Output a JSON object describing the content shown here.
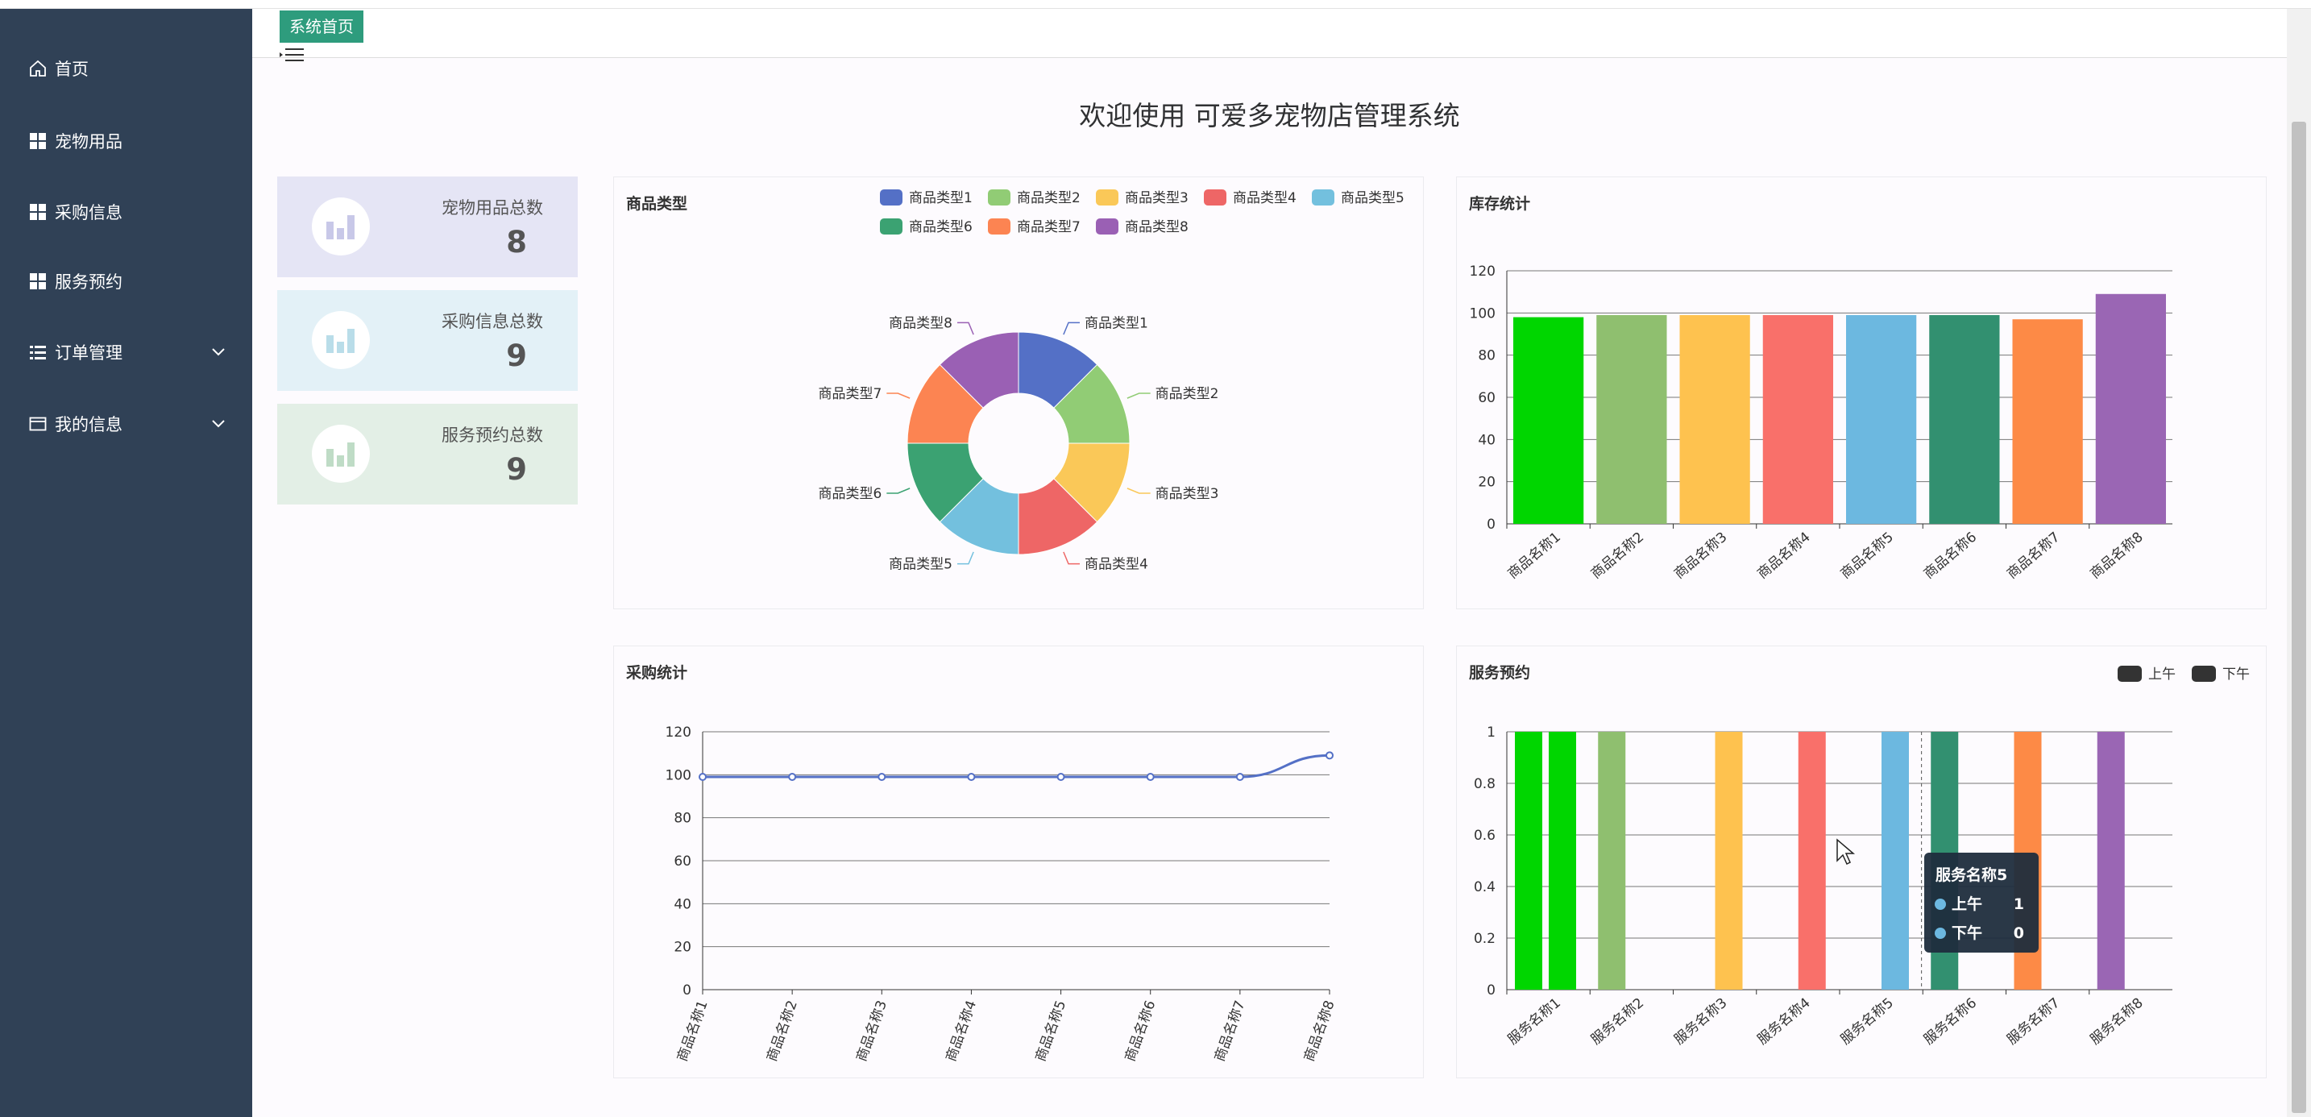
{
  "app": {
    "title": "欢迎使用 可爱多宠物店管理系统",
    "tab": "系统首页"
  },
  "sidebar": {
    "items": [
      {
        "label": "首页",
        "icon": "home-icon"
      },
      {
        "label": "宠物用品",
        "icon": "grid-icon"
      },
      {
        "label": "采购信息",
        "icon": "grid-icon"
      },
      {
        "label": "服务预约",
        "icon": "grid-icon"
      },
      {
        "label": "订单管理",
        "icon": "list-icon"
      },
      {
        "label": "我的信息",
        "icon": "card-icon"
      }
    ]
  },
  "stats": [
    {
      "label": "宠物用品总数",
      "value": "8",
      "bg": "#e5e5f5",
      "icon_color": "#c8c8e8"
    },
    {
      "label": "采购信息总数",
      "value": "9",
      "bg": "#e3f1f7",
      "icon_color": "#b9dde9"
    },
    {
      "label": "服务预约总数",
      "value": "9",
      "bg": "#e3efe6",
      "icon_color": "#bfdcc6"
    }
  ],
  "colors": {
    "sidebar": "#304156",
    "tab": "#2e9c7d",
    "line": "#5470c6"
  },
  "chart_data": [
    {
      "type": "pie",
      "title": "商品类型",
      "legend": "top-right",
      "labels": [
        "商品类型1",
        "商品类型2",
        "商品类型3",
        "商品类型4",
        "商品类型5",
        "商品类型6",
        "商品类型7",
        "商品类型8"
      ],
      "values": [
        1,
        1,
        1,
        1,
        1,
        1,
        1,
        1
      ],
      "colors": [
        "#5470c6",
        "#91cc75",
        "#fac858",
        "#ee6666",
        "#73c0de",
        "#3ba272",
        "#fc8452",
        "#9a60b4"
      ]
    },
    {
      "type": "bar",
      "title": "库存统计",
      "categories": [
        "商品名称1",
        "商品名称2",
        "商品名称3",
        "商品名称4",
        "商品名称5",
        "商品名称6",
        "商品名称7",
        "商品名称8"
      ],
      "values": [
        98,
        99,
        99,
        99,
        99,
        99,
        97,
        109
      ],
      "colors": [
        "#00d600",
        "#8fbf6f",
        "#fec24f",
        "#f9706a",
        "#6cb8e0",
        "#329070",
        "#fd8a46",
        "#9a66b4"
      ],
      "ylim": [
        0,
        120
      ],
      "yticks": [
        "0",
        "20",
        "40",
        "60",
        "80",
        "100",
        "120"
      ]
    },
    {
      "type": "line",
      "title": "采购统计",
      "categories": [
        "商品名称1",
        "商品名称2",
        "商品名称3",
        "商品名称4",
        "商品名称5",
        "商品名称6",
        "商品名称7",
        "商品名称8"
      ],
      "values": [
        99,
        99,
        99,
        99,
        99,
        99,
        99,
        109
      ],
      "ylim": [
        0,
        120
      ],
      "yticks": [
        "0",
        "20",
        "40",
        "60",
        "80",
        "100",
        "120"
      ]
    },
    {
      "type": "bar",
      "title": "服务预约",
      "legend": "top-right",
      "categories": [
        "服务名称1",
        "服务名称2",
        "服务名称3",
        "服务名称4",
        "服务名称5",
        "服务名称6",
        "服务名称7",
        "服务名称8"
      ],
      "series": [
        {
          "name": "上午",
          "values": [
            1,
            1,
            0,
            0,
            0,
            1,
            1,
            1
          ]
        },
        {
          "name": "下午",
          "values": [
            1,
            0,
            1,
            1,
            1,
            0,
            0,
            0
          ]
        }
      ],
      "colors": [
        "#00d600",
        "#8fbf6f",
        "#fec24f",
        "#f9706a",
        "#6cb8e0",
        "#329070",
        "#fd8a46",
        "#9a66b4"
      ],
      "ylim": [
        0,
        1
      ],
      "yticks": [
        "0",
        "0.2",
        "0.4",
        "0.6",
        "0.8",
        "1"
      ],
      "tooltip": {
        "title": "服务名称5",
        "rows": [
          {
            "name": "上午",
            "value": "1"
          },
          {
            "name": "下午",
            "value": "0"
          }
        ]
      }
    }
  ]
}
